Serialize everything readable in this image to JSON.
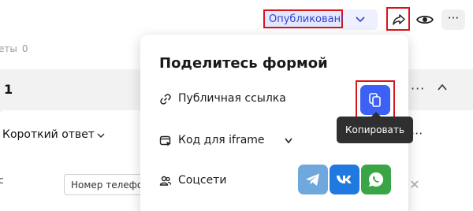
{
  "header": {
    "status_label": "Опубликована"
  },
  "background": {
    "answers_label": "еты",
    "answers_count": "0",
    "question_number": "1",
    "question_type": "Короткий ответ",
    "field_label_fragment": "с",
    "input_placeholder": "Номер телефо",
    "more_label": "···",
    "close_label": "✕"
  },
  "share_popup": {
    "title": "Поделитесь формой",
    "public_link_label": "Публичная ссылка",
    "iframe_label": "Код для iframe",
    "social_label": "Соцсети",
    "copy_tooltip": "Копировать",
    "social_icons": [
      "telegram-icon",
      "vk-icon",
      "whatsapp-icon"
    ]
  },
  "colors": {
    "accent": "#3d60f5",
    "highlight_border": "#d8151b",
    "telegram": "#6fa8dc",
    "vk": "#1f79e0",
    "whatsapp": "#3aa547"
  }
}
